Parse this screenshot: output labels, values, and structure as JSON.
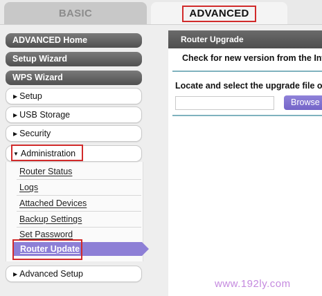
{
  "tabs": {
    "basic": "BASIC",
    "advanced": "ADVANCED"
  },
  "nav": {
    "primary": [
      "ADVANCED Home",
      "Setup Wizard",
      "WPS Wizard"
    ],
    "sections": {
      "setup": "Setup",
      "usb_storage": "USB Storage",
      "security": "Security",
      "administration": "Administration",
      "advanced_setup": "Advanced Setup"
    },
    "admin_items": [
      "Router Status",
      "Logs",
      "Attached Devices",
      "Backup Settings",
      "Set Password"
    ],
    "active_item": "Router Update"
  },
  "panel": {
    "title": "Router Upgrade",
    "check_text": "Check for new version from the Inte",
    "locate_text": "Locate and select the upgrade file or",
    "file_value": "",
    "browse_label": "Browse"
  },
  "watermark": "www.192ly.com",
  "colors": {
    "accent": "#8d7fd6",
    "highlight_box": "#d12a2a",
    "rule": "#7fb2be"
  }
}
